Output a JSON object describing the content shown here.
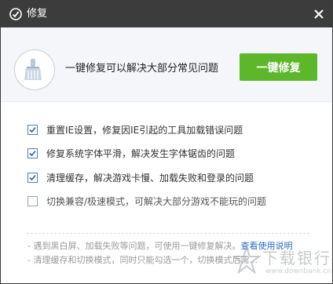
{
  "window": {
    "title": "修复",
    "close_icon": "close-icon",
    "logo_icon": "security-logo-icon"
  },
  "banner": {
    "icon": "broom-icon",
    "headline": "一键修复可以解决大部分常见问题",
    "fix_button": "一键修复",
    "button_color": "#5cb82a"
  },
  "options": [
    {
      "label": "重置IE设置，修复因IE引起的工具加载错误问题",
      "checked": true
    },
    {
      "label": "修复系统字体平滑，解决发生字体锯齿的问题",
      "checked": true
    },
    {
      "label": "清理缓存，解决游戏卡慢、加载失败和登录的问题",
      "checked": true
    },
    {
      "label": "切换兼容/极速模式，可解决大部分游戏不能玩的问题",
      "checked": false
    }
  ],
  "footer": {
    "line1_text": "- 遇到黑白屏、加载失败等问题，可使用一键修复解决。",
    "line1_link": "查看使用说明",
    "line2_text": "- 清理缓存和切换模式，同时只能勾选一个，切换模式后需..."
  },
  "watermark": {
    "text": "下载银行",
    "url": "www.downbank.cn"
  }
}
